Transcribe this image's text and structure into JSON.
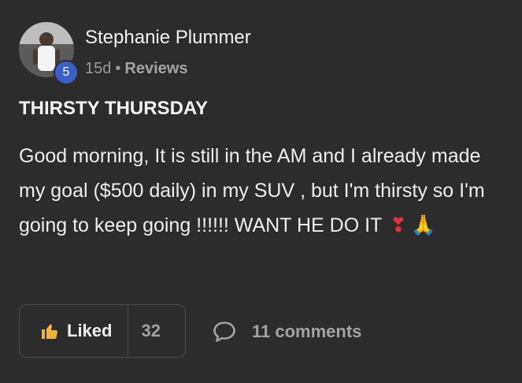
{
  "post": {
    "author": {
      "name": "Stephanie Plummer",
      "level": "5"
    },
    "meta": {
      "age": "15d",
      "separator": "•",
      "category": "Reviews"
    },
    "title": "THIRSTY THURSDAY",
    "body_text": "Good morning, It is still in the AM and I already made my goal ($500 daily) in my SUV , but I'm thirsty so I'm going to keep going !!!!!! WANT HE DO IT",
    "emojis": {
      "heart": "❣",
      "pray": "🙏"
    },
    "actions": {
      "like_label": "Liked",
      "like_count": "32",
      "comments_label": "11 comments"
    },
    "colors": {
      "background": "#2c2c2c",
      "level_badge": "#3b5fc7",
      "like_icon": "#f2b23a"
    },
    "icons": {
      "like": "thumbs-up-icon",
      "comment": "speech-bubble-icon"
    }
  }
}
